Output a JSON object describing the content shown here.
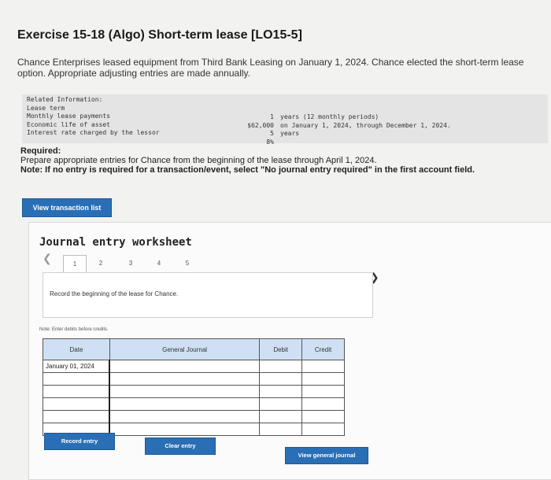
{
  "title": "Exercise 15-18 (Algo) Short-term lease [LO15-5]",
  "intro": "Chance Enterprises leased equipment from Third Bank Leasing on January 1, 2024. Chance elected the short-term lease option. Appropriate adjusting entries are made annually.",
  "related_info": {
    "heading": "Related Information:",
    "rows": [
      {
        "label": "Lease term",
        "value": "1",
        "desc": "years (12 monthly periods)"
      },
      {
        "label": "Monthly lease payments",
        "value": "$62,000",
        "desc": "on January 1, 2024, through December 1, 2024."
      },
      {
        "label": "Economic life of asset",
        "value": "5",
        "desc": "years"
      },
      {
        "label": "Interest rate charged by the lessor",
        "value": "8%",
        "desc": ""
      }
    ]
  },
  "required": {
    "heading": "Required:",
    "text": "Prepare appropriate entries for Chance from the beginning of the lease through April 1, 2024.",
    "note": "Note: If no entry is required for a transaction/event, select \"No journal entry required\" in the first account field."
  },
  "buttons": {
    "view_transactions": "View transaction list",
    "record_entry": "Record entry",
    "clear_entry": "Clear entry",
    "view_journal": "View general journal"
  },
  "worksheet": {
    "title": "Journal entry worksheet",
    "steps": [
      "1",
      "2",
      "3",
      "4",
      "5"
    ],
    "active_step": "1",
    "instruction": "Record the beginning of the lease for Chance.",
    "note": "Note: Enter debits before credits.",
    "columns": {
      "date": "Date",
      "account": "General Journal",
      "debit": "Debit",
      "credit": "Credit"
    },
    "rows": [
      {
        "date": "January 01, 2024",
        "account": "",
        "debit": "",
        "credit": ""
      },
      {
        "date": "",
        "account": "",
        "debit": "",
        "credit": ""
      },
      {
        "date": "",
        "account": "",
        "debit": "",
        "credit": ""
      },
      {
        "date": "",
        "account": "",
        "debit": "",
        "credit": ""
      },
      {
        "date": "",
        "account": "",
        "debit": "",
        "credit": ""
      },
      {
        "date": "",
        "account": "",
        "debit": "",
        "credit": ""
      }
    ]
  },
  "icons": {
    "prev": "chevron-left-icon",
    "next": "chevron-right-icon"
  },
  "colors": {
    "accent": "#2a6fb5",
    "header_fill": "#cfe0f4"
  }
}
